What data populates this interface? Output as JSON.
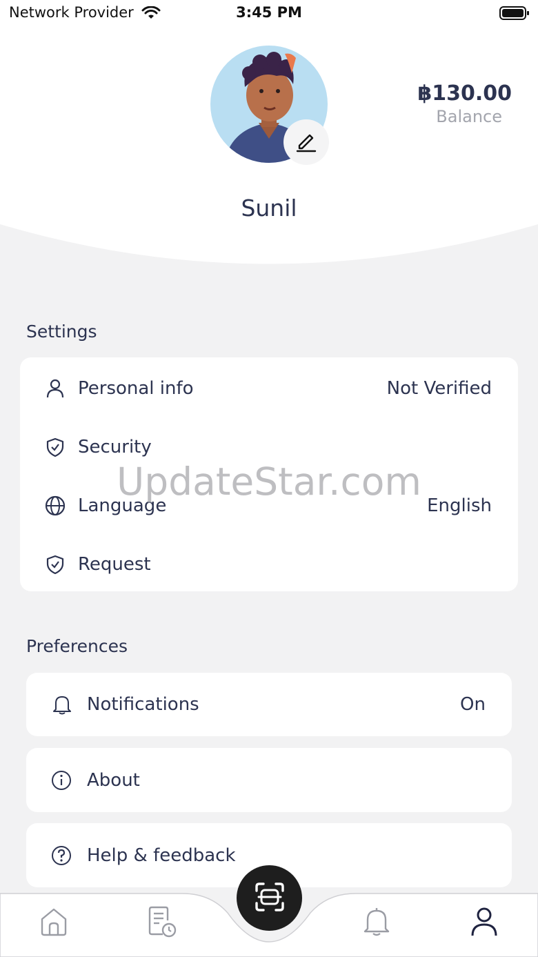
{
  "status_bar": {
    "carrier": "Network Provider",
    "time": "3:45 PM"
  },
  "profile": {
    "name": "Sunil",
    "balance": "฿130.00",
    "balance_label": "Balance"
  },
  "watermark": "UpdateStar.com",
  "settings": {
    "title": "Settings",
    "items": [
      {
        "label": "Personal info",
        "value": "Not Verified",
        "icon": "person-icon"
      },
      {
        "label": "Security",
        "value": "",
        "icon": "shield-check-icon"
      },
      {
        "label": "Language",
        "value": "English",
        "icon": "globe-icon"
      },
      {
        "label": "Request",
        "value": "",
        "icon": "shield-check-icon"
      }
    ]
  },
  "preferences": {
    "title": "Preferences",
    "items": [
      {
        "label": "Notifications",
        "value": "On",
        "icon": "bell-icon"
      },
      {
        "label": "About",
        "value": "",
        "icon": "info-icon"
      },
      {
        "label": "Help & feedback",
        "value": "",
        "icon": "help-icon"
      }
    ]
  },
  "nav": {
    "items": [
      "home-icon",
      "history-icon",
      "scan-icon",
      "notifications-icon",
      "profile-icon"
    ],
    "active": "profile-icon"
  },
  "colors": {
    "text": "#2c3350",
    "muted": "#a3a5ad",
    "background": "#f2f2f3",
    "card": "#ffffff",
    "scan_button": "#1e1e1e"
  }
}
